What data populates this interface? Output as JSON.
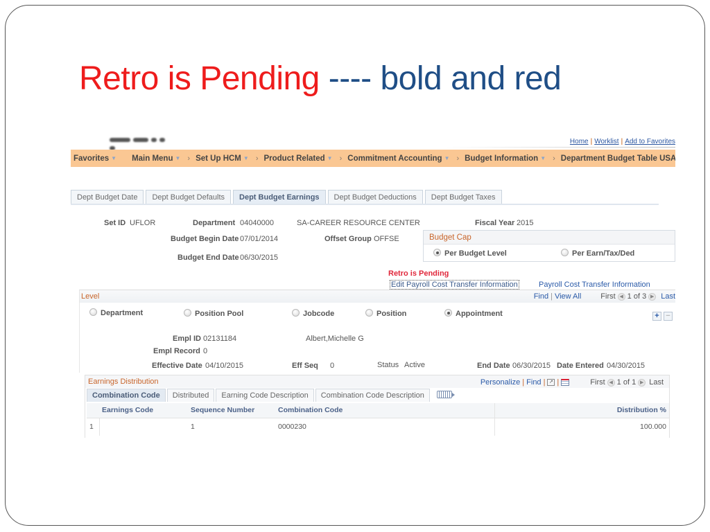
{
  "slide": {
    "title_red": "Retro is Pending",
    "title_blue": " ---- bold and red",
    "colors": {
      "title_red": "#ee1c1c",
      "title_blue": "#1f4e86"
    }
  },
  "app": {
    "top_links": [
      "Home",
      "Worklist",
      "Add to Favorites"
    ],
    "navbar": {
      "favorites": "Favorites",
      "main_menu": "Main Menu",
      "breadcrumbs": [
        "Set Up HCM",
        "Product Related",
        "Commitment Accounting",
        "Budget Information",
        "Department Budget Table USA"
      ],
      "color": "#fac793"
    },
    "tabs": [
      {
        "label": "Dept Budget Date",
        "active": false
      },
      {
        "label": "Dept Budget Defaults",
        "active": false
      },
      {
        "label": "Dept Budget Earnings",
        "active": true
      },
      {
        "label": "Dept Budget Deductions",
        "active": false
      },
      {
        "label": "Dept Budget Taxes",
        "active": false
      }
    ],
    "header": {
      "setid_label": "Set ID",
      "setid": "UFLOR",
      "dept_label": "Department",
      "dept": "04040000",
      "dept_name": "SA-CAREER RESOURCE CENTER",
      "fy_label": "Fiscal Year",
      "fy": "2015",
      "begin_label": "Budget Begin Date",
      "begin": "07/01/2014",
      "offset_label": "Offset Group",
      "offset": "OFFSE",
      "end_label": "Budget End Date",
      "end": "06/30/2015"
    },
    "budget_cap": {
      "title": "Budget Cap",
      "options": [
        {
          "label": "Per Budget Level",
          "selected": true
        },
        {
          "label": "Per Earn/Tax/Ded",
          "selected": false
        }
      ]
    },
    "retro_status": "Retro is Pending",
    "edit_pct_link": "Edit Payroll Cost Transfer Information",
    "pct_link": "Payroll Cost Transfer Information",
    "level": {
      "title": "Level",
      "find": "Find",
      "view_all": "View All",
      "first": "First",
      "pager": "1 of 3",
      "last": "Last",
      "options": [
        {
          "label": "Department",
          "selected": false
        },
        {
          "label": "Position Pool",
          "selected": false
        },
        {
          "label": "Jobcode",
          "selected": false
        },
        {
          "label": "Position",
          "selected": false
        },
        {
          "label": "Appointment",
          "selected": true
        }
      ],
      "emplid_label": "Empl ID",
      "emplid": "02131184",
      "name": "Albert,Michelle G",
      "emplrec_label": "Empl Record",
      "emplrec": "0",
      "effdt_label": "Effective Date",
      "effdt": "04/10/2015",
      "effseq_label": "Eff Seq",
      "effseq": "0",
      "status_label": "Status",
      "status": "Active",
      "enddate_label": "End Date",
      "enddate": "06/30/2015",
      "entered_label": "Date Entered",
      "entered": "04/30/2015"
    },
    "earnings": {
      "title": "Earnings Distribution",
      "personalize": "Personalize",
      "find": "Find",
      "first": "First",
      "pager": "1 of 1",
      "last": "Last",
      "tabs": [
        {
          "label": "Combination Code",
          "active": true
        },
        {
          "label": "Distributed",
          "active": false
        },
        {
          "label": "Earning Code Description",
          "active": false
        },
        {
          "label": "Combination Code Description",
          "active": false
        }
      ],
      "columns": [
        "",
        "Earnings Code",
        "Sequence Number",
        "Combination Code",
        "Distribution %"
      ],
      "rows": [
        {
          "row": "1",
          "earnings_code": "",
          "sequence": "1",
          "combo_code": "0000230",
          "distribution": "100.000"
        }
      ]
    }
  }
}
